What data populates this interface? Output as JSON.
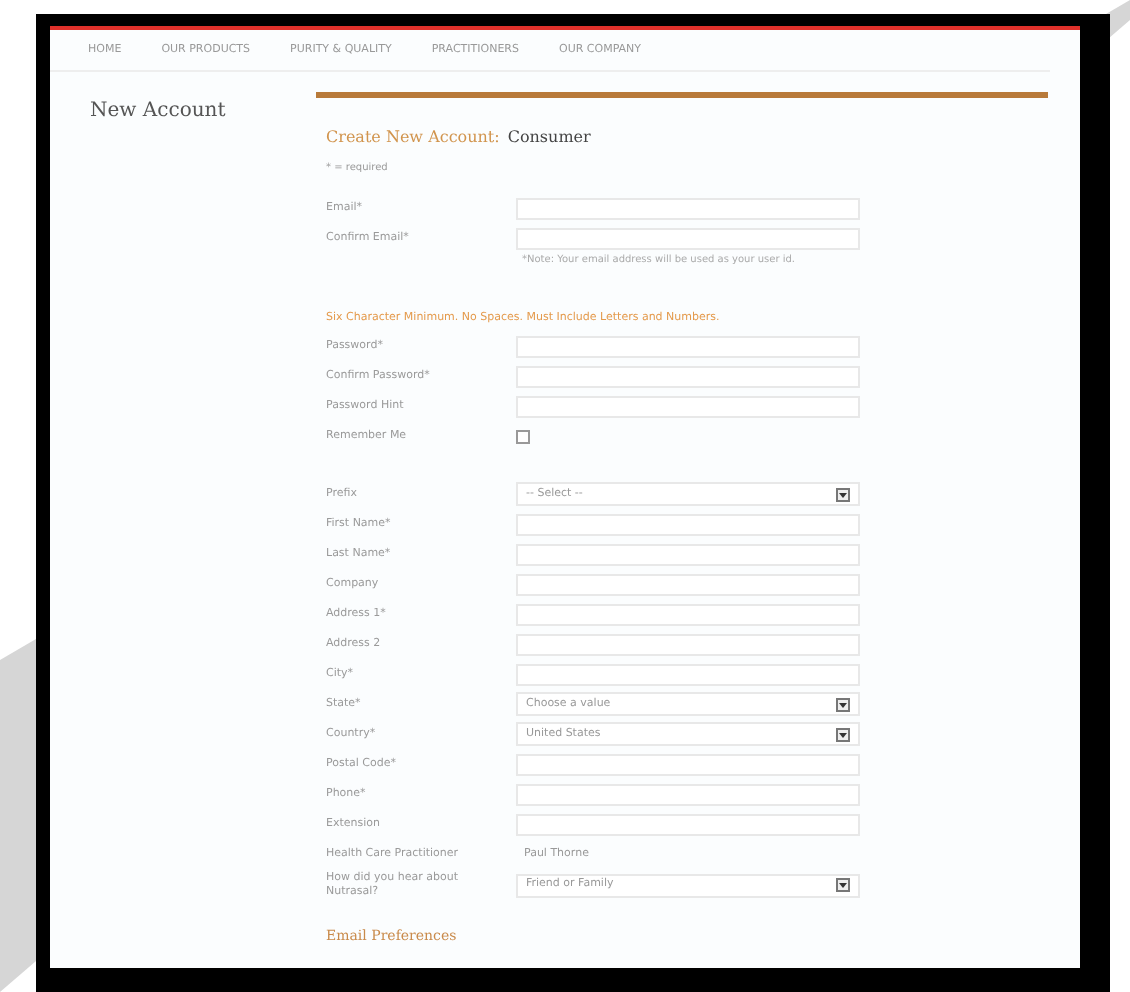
{
  "nav": [
    "HOME",
    "OUR PRODUCTS",
    "PURITY & QUALITY",
    "PRACTITIONERS",
    "OUR COMPANY"
  ],
  "sidebar_title": "New Account",
  "heading": {
    "main": "Create New Account:",
    "sub": "Consumer"
  },
  "required_note": "* = required",
  "rows": [
    {
      "kind": "text",
      "label": "Email*"
    },
    {
      "kind": "text",
      "label": "Confirm Email*"
    },
    {
      "kind": "note",
      "text": "*Note: Your email address will be used as your user id."
    },
    {
      "kind": "gap"
    },
    {
      "kind": "warning",
      "text": "Six Character Minimum. No Spaces. Must Include Letters and Numbers."
    },
    {
      "kind": "text",
      "label": "Password*"
    },
    {
      "kind": "text",
      "label": "Confirm Password*"
    },
    {
      "kind": "text",
      "label": "Password Hint"
    },
    {
      "kind": "checkbox",
      "label": "Remember Me",
      "checked": false
    },
    {
      "kind": "gap"
    },
    {
      "kind": "select",
      "label": "Prefix",
      "value": "-- Select --"
    },
    {
      "kind": "text",
      "label": "First Name*"
    },
    {
      "kind": "text",
      "label": "Last Name*"
    },
    {
      "kind": "text",
      "label": "Company"
    },
    {
      "kind": "text",
      "label": "Address 1*"
    },
    {
      "kind": "text",
      "label": "Address 2"
    },
    {
      "kind": "text",
      "label": "City*"
    },
    {
      "kind": "select",
      "label": "State*",
      "value": "Choose a value"
    },
    {
      "kind": "select",
      "label": "Country*",
      "value": "United States"
    },
    {
      "kind": "text",
      "label": "Postal Code*"
    },
    {
      "kind": "text",
      "label": "Phone*"
    },
    {
      "kind": "text",
      "label": "Extension"
    },
    {
      "kind": "static",
      "label": "Health Care Practitioner",
      "value": "Paul Thorne"
    },
    {
      "kind": "select",
      "label": "How did you hear about Nutrasal?",
      "value": "Friend or Family"
    }
  ],
  "section_title": "Email Preferences"
}
